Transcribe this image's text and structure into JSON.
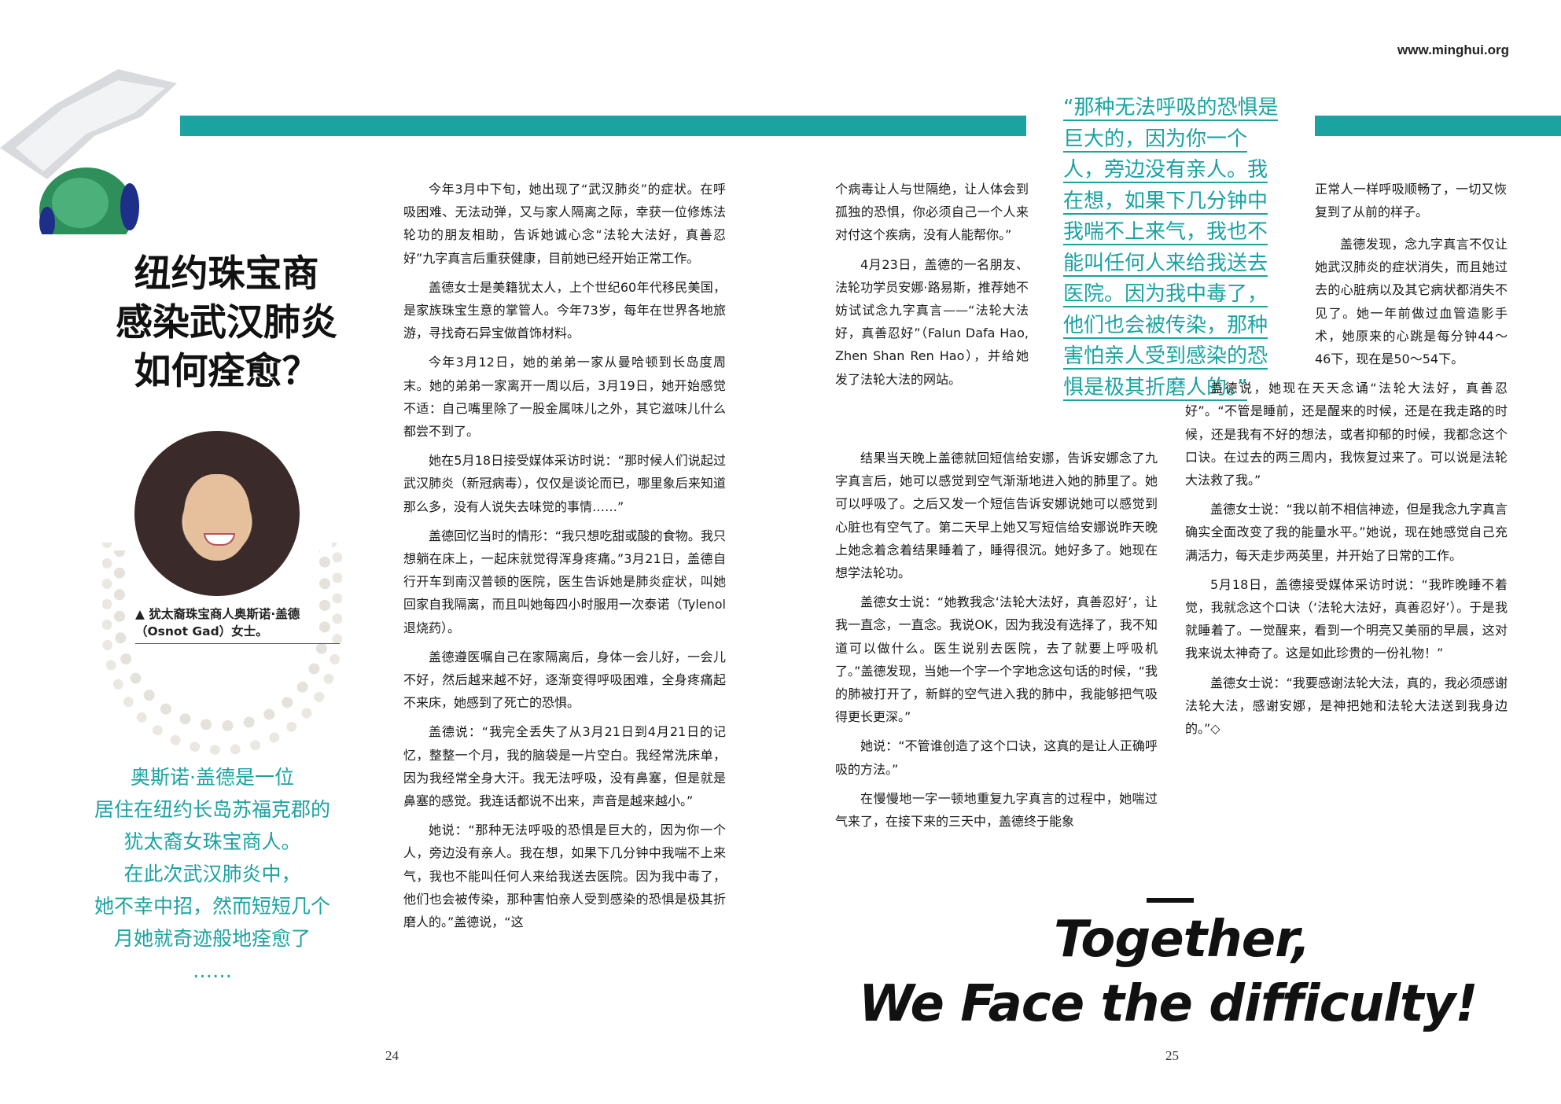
{
  "header": {
    "website": "www.minghui.org"
  },
  "colors": {
    "accent": "#1aa3a1",
    "text": "#1a1a1a"
  },
  "title_lines": [
    "纽约珠宝商",
    "感染武汉肺炎",
    "如何痊愈？"
  ],
  "photo_caption": "▲ 犹太裔珠宝商人奥斯诺·盖德（Osnot Gad）女士。",
  "summary_lines": [
    "奥斯诺·盖德是一位",
    "居住在纽约长岛苏福克郡的",
    "犹太裔女珠宝商人。",
    "在此次武汉肺炎中，",
    "她不幸中招，然而短短几个",
    "月她就奇迹般地痊愈了",
    "……"
  ],
  "column1": [
    "今年3月中下旬，她出现了“武汉肺炎”的症状。在呼吸困难、无法动弹，又与家人隔离之际，幸获一位修炼法轮功的朋友相助，告诉她诚心念“法轮大法好，真善忍好”九字真言后重获健康，目前她已经开始正常工作。",
    "盖德女士是美籍犹太人，上个世纪60年代移民美国，是家族珠宝生意的掌管人。今年73岁，每年在世界各地旅游，寻找奇石异宝做首饰材料。",
    "今年3月12日，她的弟弟一家从曼哈顿到长岛度周末。她的弟弟一家离开一周以后，3月19日，她开始感觉不适：自己嘴里除了一股金属味儿之外，其它滋味儿什么都尝不到了。",
    "她在5月18日接受媒体采访时说：“那时候人们说起过武汉肺炎（新冠病毒），仅仅是谈论而已，哪里象后来知道那么多，没有人说失去味觉的事情……”",
    "盖德回忆当时的情形：“我只想吃甜或酸的食物。我只想躺在床上，一起床就觉得浑身疼痛。”3月21日，盖德自行开车到南汉普顿的医院，医生告诉她是肺炎症状，叫她回家自我隔离，而且叫她每四小时服用一次泰诺（Tylenol 退烧药）。",
    "盖德遵医嘱自己在家隔离后，身体一会儿好，一会儿不好，然后越来越不好，逐渐变得呼吸困难，全身疼痛起不来床，她感到了死亡的恐惧。",
    "盖德说：“我完全丢失了从3月21日到4月21日的记忆，整整一个月，我的脑袋是一片空白。我经常洗床单，因为我经常全身大汗。我无法呼吸，没有鼻塞，但是就是鼻塞的感觉。我连话都说不出来，声音是越来越小。”",
    "她说：“那种无法呼吸的恐惧是巨大的，因为你一个人，旁边没有亲人。我在想，如果下几分钟中我喘不上来气，我也不能叫任何人来给我送去医院。因为我中毒了，他们也会被传染，那种害怕亲人受到感染的恐惧是极其折磨人的。”盖德说，“这"
  ],
  "column2": [
    "个病毒让人与世隔绝，让人体会到孤独的恐惧，你必须自己一个人来对付这个疾病，没有人能帮你。”",
    "4月23日，盖德的一名朋友、法轮功学员安娜·路易斯，推荐她不妨试试念九字真言——“法轮大法好，真善忍好”（Falun Dafa Hao, Zhen Shan Ren Hao），并给她发了法轮大法的网站。"
  ],
  "pull_quote": "“那种无法呼吸的恐惧是巨大的，因为你一个人，旁边没有亲人。我在想，如果下几分钟中我喘不上来气，我也不能叫任何人来给我送去医院。因为我中毒了，他们也会被传染，那种害怕亲人受到感染的恐惧是极其折磨人的。”",
  "column2_wide": [
    "结果当天晚上盖德就回短信给安娜，告诉安娜念了九字真言后，她可以感觉到空气渐渐地进入她的肺里了。她可以呼吸了。之后又发一个短信告诉安娜说她可以感觉到心脏也有空气了。第二天早上她又写短信给安娜说昨天晚上她念着念着结果睡着了，睡得很沉。她好多了。她现在想学法轮功。",
    "盖德女士说：“她教我念‘法轮大法好，真善忍好’，让我一直念，一直念。我说OK，因为我没有选择了，我不知道可以做什么。医生说别去医院，去了就要上呼吸机了。”盖德发现，当她一个字一个字地念这句话的时候，“我的肺被打开了，新鲜的空气进入我的肺中，我能够把气吸得更长更深。”",
    "她说：“不管谁创造了这个口诀，这真的是让人正确呼吸的方法。”",
    "在慢慢地一字一顿地重复九字真言的过程中，她喘过气来了，在接下来的三天中，盖德终于能象"
  ],
  "column3_top": [
    "正常人一样呼吸顺畅了，一切又恢复到了从前的样子。"
  ],
  "column3": [
    "盖德发现，念九字真言不仅让她武汉肺炎的症状消失，而且她过去的心脏病以及其它病状都消失不见了。她一年前做过血管造影手术，她原来的心跳是每分钟44～46下，现在是50～54下。",
    "盖德说，她现在天天念诵“法轮大法好，真善忍好”。“不管是睡前，还是醒来的时候，还是在我走路的时候，还是我有不好的想法，或者抑郁的时候，我都念这个口诀。在过去的两三周内，我恢复过来了。可以说是法轮大法救了我。”",
    "盖德女士说：“我以前不相信神迹，但是我念九字真言确实全面改变了我的能量水平。”她说，现在她感觉自己充满活力，每天走步两英里，并开始了日常的工作。",
    "5月18日，盖德接受媒体采访时说：“我昨晚睡不着觉，我就念这个口诀（‘法轮大法好，真善忍好’）。于是我就睡着了。一觉醒来，看到一个明亮又美丽的早晨，这对我来说太神奇了。这是如此珍贵的一份礼物！”",
    "盖德女士说：“我要感谢法轮大法，真的，我必须感谢法轮大法，感谢安娜，是神把她和法轮大法送到我身边的。”◇"
  ],
  "slogan": [
    "Together,",
    "We Face the difficulty!"
  ],
  "page_numbers": {
    "left": "24",
    "right": "25"
  }
}
